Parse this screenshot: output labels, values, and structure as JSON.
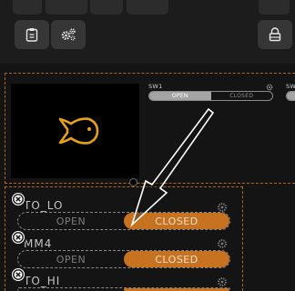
{
  "toolbar": {
    "clipboard_icon": "clipboard-icon",
    "settings_icon": "gears-icon",
    "lock_icon": "lock-icon"
  },
  "camera": {
    "placeholder_icon": "fish-icon",
    "accent": "#e3a21a"
  },
  "switches_top": [
    {
      "label": "SW1",
      "on_label": "OPEN",
      "off_label": "CLOSED",
      "state": "OPEN"
    },
    {
      "label": "SW",
      "state": "partial"
    }
  ],
  "switch_rows": [
    {
      "label": "TO_LO",
      "off_label": "OPEN",
      "on_label": "CLOSED",
      "state": "CLOSED"
    },
    {
      "label": "MM4",
      "off_label": "OPEN",
      "on_label": "CLOSED",
      "state": "CLOSED"
    },
    {
      "label": "TO_HI",
      "state": "CLOSED"
    }
  ],
  "colors": {
    "accent": "#c67220",
    "border": "#b2651c"
  }
}
